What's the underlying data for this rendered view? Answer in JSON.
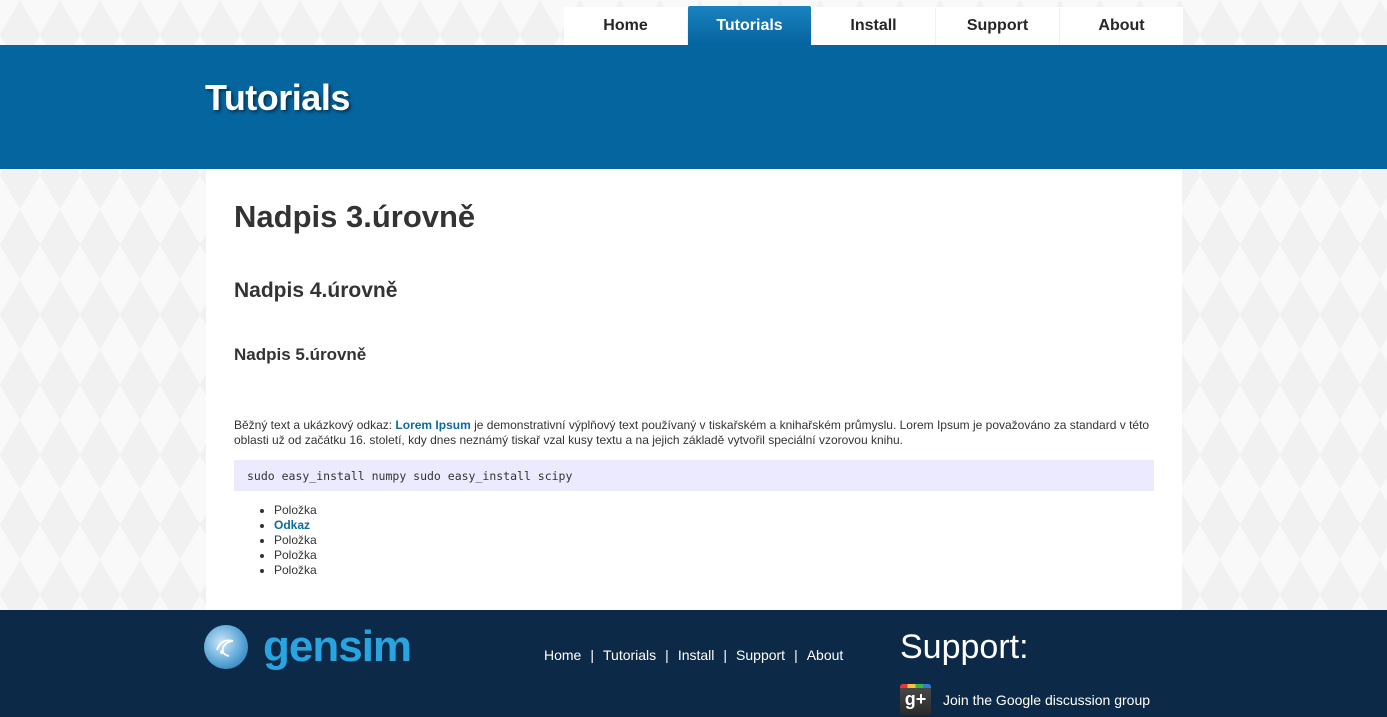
{
  "nav": {
    "items": [
      {
        "label": "Home",
        "active": false
      },
      {
        "label": "Tutorials",
        "active": true
      },
      {
        "label": "Install",
        "active": false
      },
      {
        "label": "Support",
        "active": false
      },
      {
        "label": "About",
        "active": false
      }
    ]
  },
  "banner": {
    "title": "Tutorials"
  },
  "content": {
    "h3": "Nadpis 3.úrovně",
    "h4": "Nadpis 4.úrovně",
    "h5": "Nadpis 5.úrovně",
    "para_before": "Běžný text a ukázkový odkaz: ",
    "para_link": "Lorem Ipsum",
    "para_after": " je demonstrativní výplňový text používaný v tiskařském a knihařském průmyslu. Lorem Ipsum je považováno za standard v této oblasti už od začátku 16. století, kdy dnes neznámý tiskař vzal kusy textu a na jejich základě vytvořil speciální vzorovou knihu.",
    "code": "sudo easy_install numpy sudo easy_install scipy",
    "list": [
      {
        "label": "Položka",
        "link": false
      },
      {
        "label": "Odkaz",
        "link": true
      },
      {
        "label": "Položka",
        "link": false
      },
      {
        "label": "Položka",
        "link": false
      },
      {
        "label": "Položka",
        "link": false
      }
    ]
  },
  "footer": {
    "logo_text": "gensim",
    "links": [
      "Home",
      "Tutorials",
      "Install",
      "Support",
      "About"
    ],
    "separator": "|",
    "support_title": "Support:",
    "support_text": "Join the Google discussion group",
    "gplus_glyph": "g+"
  },
  "colors": {
    "brand_blue": "#05659f",
    "footer_bg": "#0c2a47",
    "link": "#0d6a9e",
    "code_bg": "#eceaff"
  }
}
